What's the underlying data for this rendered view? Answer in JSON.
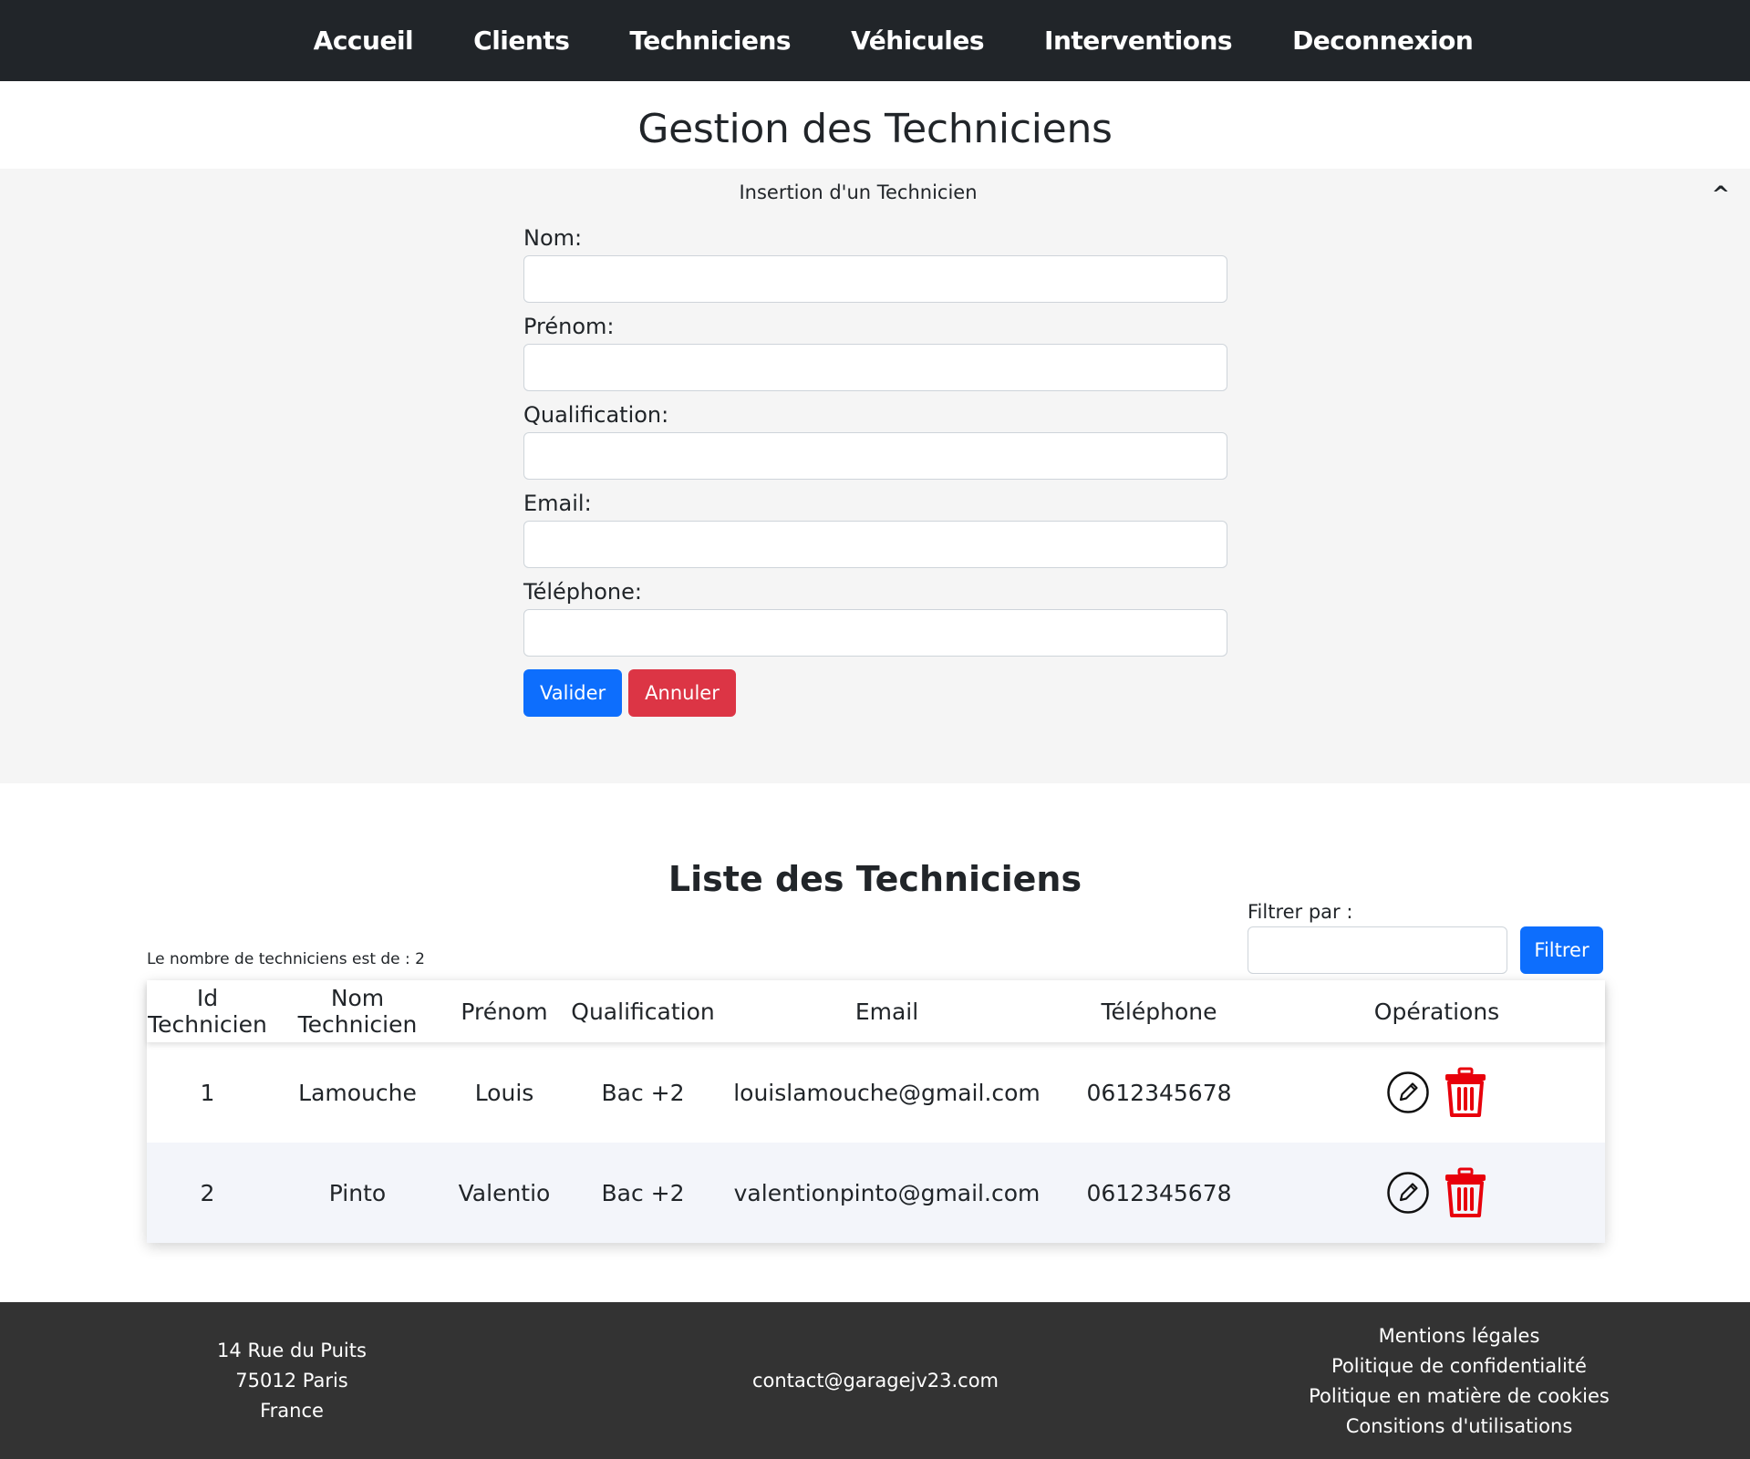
{
  "nav": {
    "items": [
      {
        "label": "Accueil"
      },
      {
        "label": "Clients"
      },
      {
        "label": "Techniciens"
      },
      {
        "label": "Véhicules"
      },
      {
        "label": "Interventions"
      },
      {
        "label": "Deconnexion"
      }
    ]
  },
  "page": {
    "title": "Gestion des Techniciens"
  },
  "form": {
    "header": "Insertion d'un Technicien",
    "toggle": "^",
    "fields": [
      {
        "label": "Nom:",
        "value": ""
      },
      {
        "label": "Prénom:",
        "value": ""
      },
      {
        "label": "Qualification:",
        "value": ""
      },
      {
        "label": "Email:",
        "value": ""
      },
      {
        "label": "Téléphone:",
        "value": ""
      }
    ],
    "submit_label": "Valider",
    "cancel_label": "Annuler"
  },
  "list": {
    "title": "Liste des Techniciens",
    "count_text": "Le nombre de techniciens est de : 2",
    "filter_label": "Filtrer par :",
    "filter_value": "",
    "filter_button": "Filtrer",
    "columns": [
      "Id Technicien",
      "Nom Technicien",
      "Prénom",
      "Qualification",
      "Email",
      "Téléphone",
      "Opérations"
    ],
    "rows": [
      {
        "id": "1",
        "nom": "Lamouche",
        "prenom": "Louis",
        "qualification": "Bac +2",
        "email": "louislamouche@gmail.com",
        "telephone": "0612345678"
      },
      {
        "id": "2",
        "nom": "Pinto",
        "prenom": "Valentio",
        "qualification": "Bac +2",
        "email": "valentionpinto@gmail.com",
        "telephone": "0612345678"
      }
    ]
  },
  "footer": {
    "address": [
      "14 Rue du Puits",
      "75012 Paris",
      "France"
    ],
    "contact": "contact@garagejv23.com",
    "links": [
      "Mentions légales",
      "Politique de confidentialité",
      "Politique en matière de cookies",
      "Consitions d'utilisations"
    ]
  },
  "colors": {
    "nav_bg": "#212529",
    "primary": "#0d6efd",
    "danger": "#dc3545",
    "delete_icon": "#e8000b",
    "footer_bg": "#333333",
    "panel_bg": "#f5f5f5"
  },
  "icons": {
    "edit": "pencil-circle-icon",
    "delete": "trash-icon"
  }
}
